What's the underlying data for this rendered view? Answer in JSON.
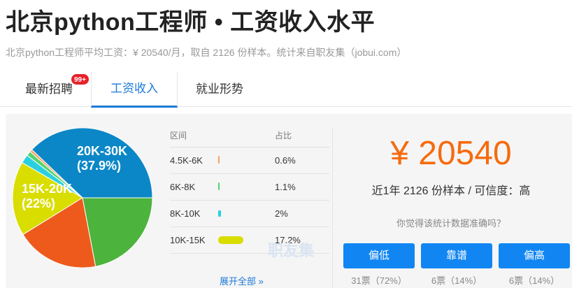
{
  "header": {
    "title": "北京python工程师 • 工资收入水平",
    "subtitle": "北京python工程师平均工资：¥ 20540/月，取自 2126 份样本。统计来自职友集（jobui.com）"
  },
  "tabs": [
    {
      "label": "最新招聘",
      "badge": "99+"
    },
    {
      "label": "工资收入",
      "active": true
    },
    {
      "label": "就业形势"
    }
  ],
  "pie": {
    "labels": [
      {
        "line1": "20K-30K",
        "line2": "(37.9%)"
      },
      {
        "line1": "15K-20K",
        "line2": "(22%)"
      }
    ]
  },
  "table": {
    "headers": [
      "区间",
      "占比"
    ],
    "rows": [
      {
        "range": "4.5K-6K",
        "pct": "0.6%"
      },
      {
        "range": "6K-8K",
        "pct": "1.1%"
      },
      {
        "range": "8K-10K",
        "pct": "2%"
      },
      {
        "range": "10K-15K",
        "pct": "17.2%"
      }
    ],
    "more_label": "展开全部 »"
  },
  "watermark": "职友集",
  "summary": {
    "salary": "¥ 20540",
    "sample": "近1年 2126 份样本 / 可信度：高",
    "question": "你觉得该统计数据准确吗？"
  },
  "votes": [
    {
      "label": "偏低",
      "count": "31票（72%）"
    },
    {
      "label": "靠谱",
      "count": "6票（14%）"
    },
    {
      "label": "偏高",
      "count": "6票（14%）"
    }
  ],
  "chart_data": {
    "type": "pie",
    "slices": [
      {
        "label": "20K-30K",
        "value": 37.9,
        "color": "#0b87c7"
      },
      {
        "label": "4.5K-6K",
        "value": 0.6,
        "color": "#f5a263"
      },
      {
        "label": "6K-8K",
        "value": 1.1,
        "color": "#55d46e"
      },
      {
        "label": "8K-10K",
        "value": 2,
        "color": "#2ad0e0"
      },
      {
        "label": "10K-15K",
        "value": 17.2,
        "color": "#d9dd00"
      },
      {
        "label": "",
        "value": 19.2,
        "color": "#ee5a1c"
      },
      {
        "label": "15K-20K",
        "value": 22,
        "color": "#4cb33c"
      }
    ],
    "bar_colors": [
      "#f5a263",
      "#55d46e",
      "#2ad0e0",
      "#d9dd00"
    ]
  }
}
